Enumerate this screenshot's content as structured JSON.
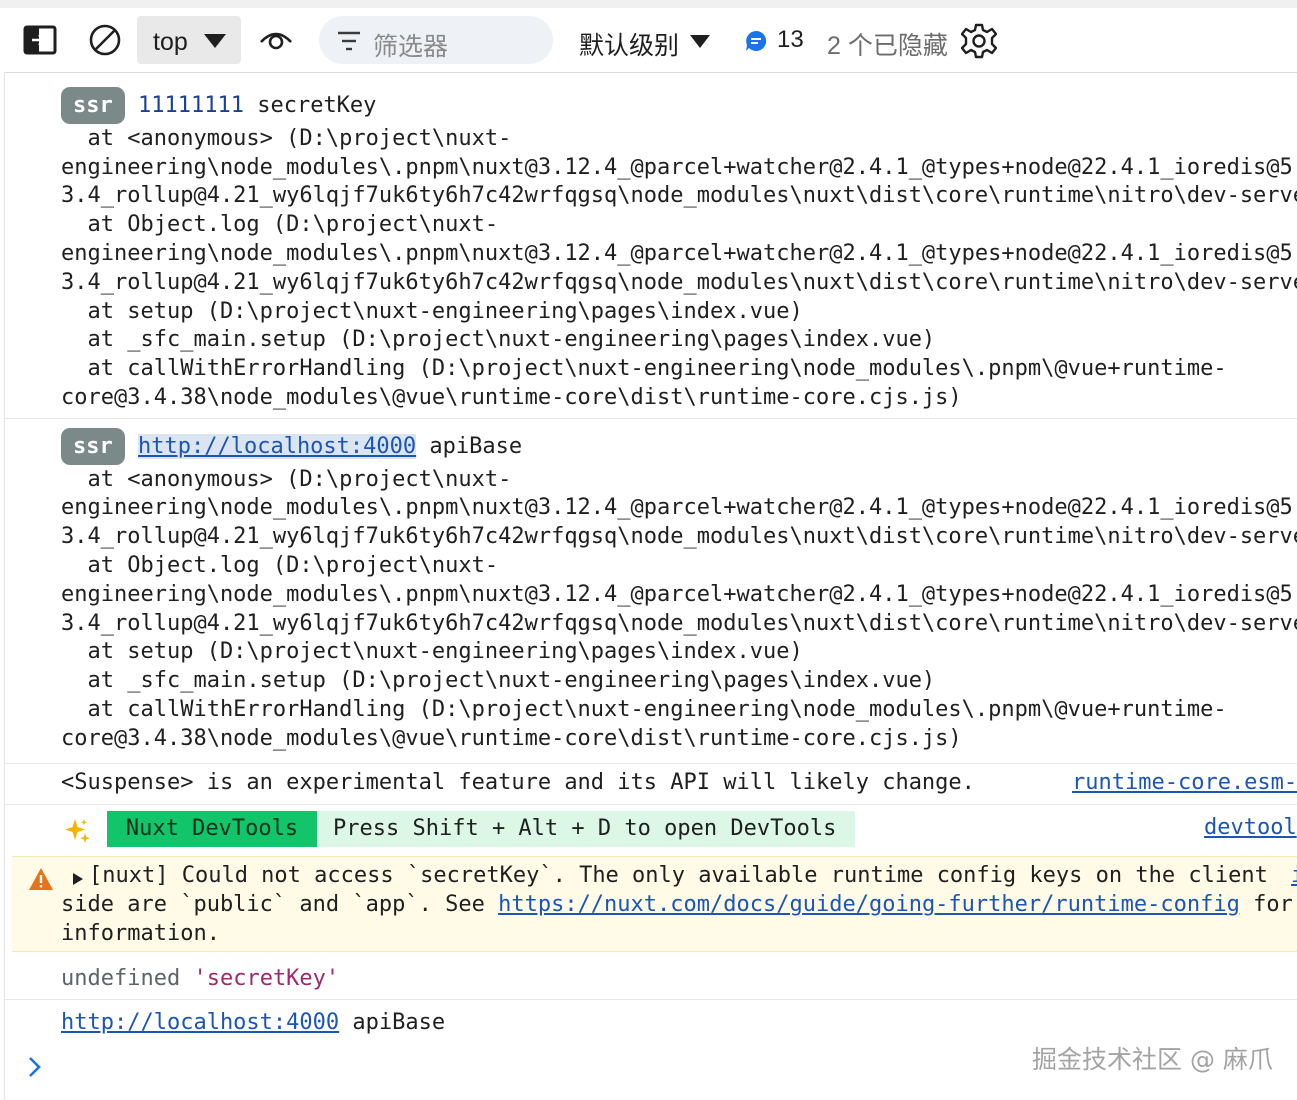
{
  "toolbar": {
    "context_value": "top",
    "filter_placeholder": "筛选器",
    "levels_label": "默认级别",
    "message_count": "13",
    "hidden_label": "2 个已隐藏"
  },
  "messages": {
    "m1": {
      "badge": "ssr",
      "value": "11111111",
      "text": " secretKey",
      "stack": [
        "  at <anonymous> (D:\\project\\nuxt-",
        "engineering\\node_modules\\.pnpm\\nuxt@3.12.4_@parcel+watcher@2.4.1_@types+node@22.4.1_ioredis@5.",
        "3.4_rollup@4.21_wy6lqjf7uk6ty6h7c42wrfqgsq\\node_modules\\nuxt\\dist\\core\\runtime\\nitro\\dev-serve",
        "  at Object.log (D:\\project\\nuxt-",
        "engineering\\node_modules\\.pnpm\\nuxt@3.12.4_@parcel+watcher@2.4.1_@types+node@22.4.1_ioredis@5.",
        "3.4_rollup@4.21_wy6lqjf7uk6ty6h7c42wrfqgsq\\node_modules\\nuxt\\dist\\core\\runtime\\nitro\\dev-serve",
        "  at setup (D:\\project\\nuxt-engineering\\pages\\index.vue)",
        "  at _sfc_main.setup (D:\\project\\nuxt-engineering\\pages\\index.vue)",
        "  at callWithErrorHandling (D:\\project\\nuxt-engineering\\node_modules\\.pnpm\\@vue+runtime-",
        "core@3.4.38\\node_modules\\@vue\\runtime-core\\dist\\runtime-core.cjs.js)"
      ]
    },
    "m2": {
      "badge": "ssr",
      "link": "http://localhost:4000",
      "text": " apiBase",
      "stack": [
        "  at <anonymous> (D:\\project\\nuxt-",
        "engineering\\node_modules\\.pnpm\\nuxt@3.12.4_@parcel+watcher@2.4.1_@types+node@22.4.1_ioredis@5.",
        "3.4_rollup@4.21_wy6lqjf7uk6ty6h7c42wrfqgsq\\node_modules\\nuxt\\dist\\core\\runtime\\nitro\\dev-serve",
        "  at Object.log (D:\\project\\nuxt-",
        "engineering\\node_modules\\.pnpm\\nuxt@3.12.4_@parcel+watcher@2.4.1_@types+node@22.4.1_ioredis@5.",
        "3.4_rollup@4.21_wy6lqjf7uk6ty6h7c42wrfqgsq\\node_modules\\nuxt\\dist\\core\\runtime\\nitro\\dev-serve",
        "  at setup (D:\\project\\nuxt-engineering\\pages\\index.vue)",
        "  at _sfc_main.setup (D:\\project\\nuxt-engineering\\pages\\index.vue)",
        "  at callWithErrorHandling (D:\\project\\nuxt-engineering\\node_modules\\.pnpm\\@vue+runtime-",
        "core@3.4.38\\node_modules\\@vue\\runtime-core\\dist\\runtime-core.cjs.js)"
      ]
    },
    "m3": {
      "text": "<Suspense> is an experimental feature and its API will likely change.",
      "source": "runtime-core.esm-"
    },
    "m4": {
      "button": "Nuxt DevTools",
      "hint": "Press Shift + Alt + D to open DevTools",
      "source": "devtool"
    },
    "m5": {
      "line1": "[nuxt] Could not access `secretKey`. The only available runtime config keys on the client",
      "source_fragment": "i",
      "line2_before": "side are `public` and `app`. See ",
      "link": "https://nuxt.com/docs/guide/going-further/runtime-config",
      "line2_after": " for",
      "line3": "information."
    },
    "m6": {
      "value": "undefined",
      "string": "'secretKey'"
    },
    "m7": {
      "link": "http://localhost:4000",
      "text": " apiBase"
    }
  },
  "watermark": "掘金技术社区 @ 麻爪",
  "colors": {
    "badge": "#7b8a89",
    "link": "#1a56b8",
    "string": "#a0286c",
    "devtools_green": "#12c46a",
    "warning_bg": "#fffbe6",
    "warning_icon": "#e8711b",
    "accent_blue": "#1a73e8"
  },
  "icons": [
    "dock-side-icon",
    "clear-console-icon",
    "chevron-down-icon",
    "eye-icon",
    "filter-icon",
    "message-icon",
    "gear-icon",
    "sparkles-icon",
    "warning-icon",
    "expand-triangle-icon",
    "prompt-chevron-icon"
  ]
}
